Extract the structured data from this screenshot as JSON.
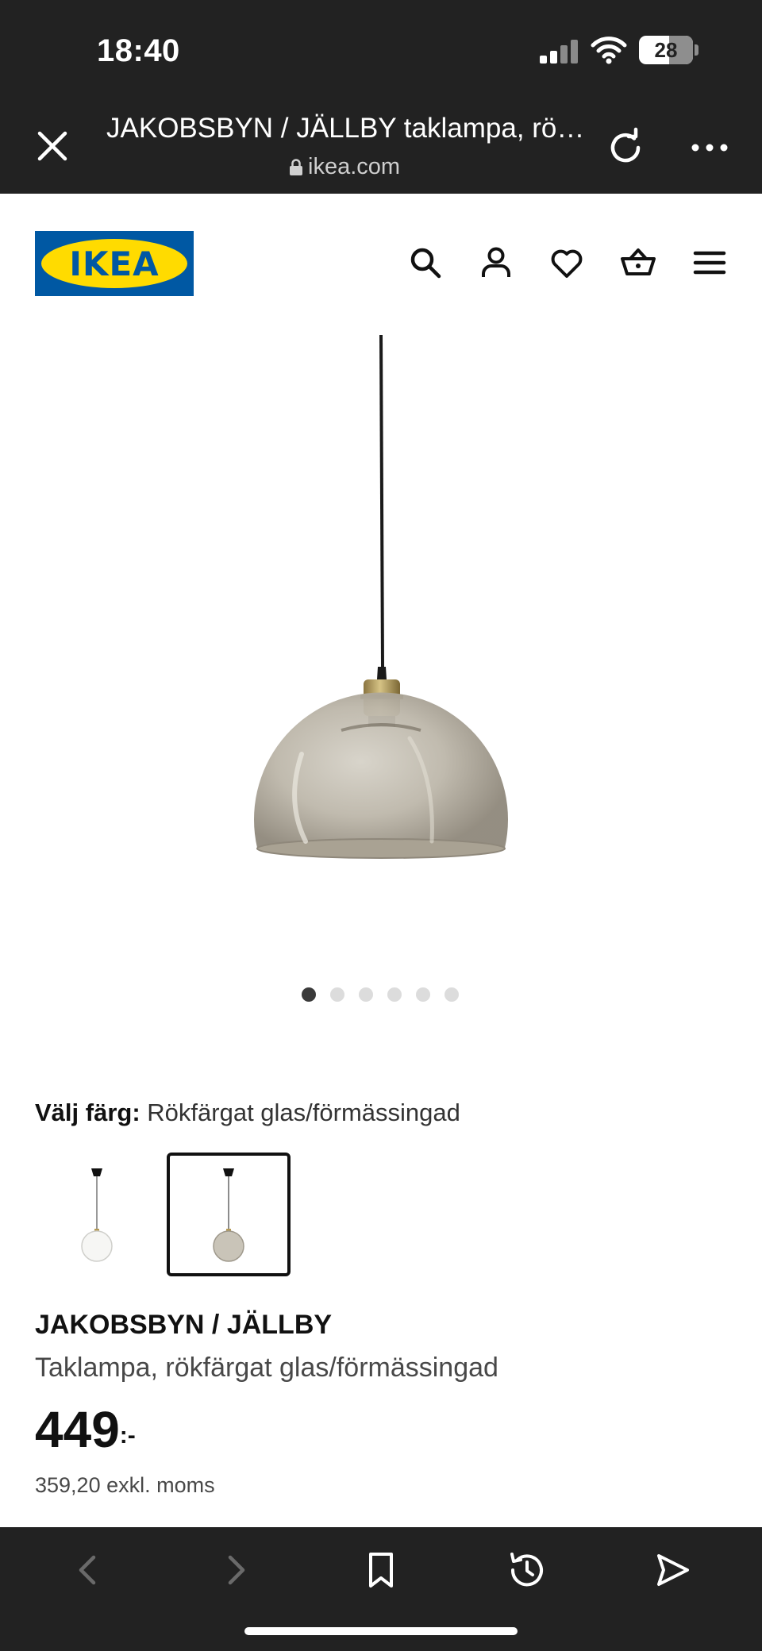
{
  "status_bar": {
    "time": "18:40",
    "battery": "28"
  },
  "browser": {
    "title": "JAKOBSBYN / JÄLLBY taklampa, rö…",
    "url": "ikea.com"
  },
  "header": {
    "logo_text": "IKEA"
  },
  "gallery": {
    "dots": [
      {
        "active": true
      },
      {
        "active": false
      },
      {
        "active": false
      },
      {
        "active": false
      },
      {
        "active": false
      },
      {
        "active": false
      }
    ]
  },
  "color": {
    "label": "Välj färg:",
    "value": "Rökfärgat glas/förmässingad",
    "options": [
      {
        "name": "clear",
        "selected": false
      },
      {
        "name": "smoked",
        "selected": true
      }
    ]
  },
  "product": {
    "name": "JAKOBSBYN / JÄLLBY",
    "description": "Taklampa, rökfärgat glas/förmässingad",
    "price": "449",
    "price_suffix": ":-",
    "price_excl": "359,20 exkl. moms"
  },
  "colors": {
    "ikea_blue": "#0058a3",
    "ikea_yellow": "#ffdb00",
    "chrome_dark": "#222222"
  }
}
